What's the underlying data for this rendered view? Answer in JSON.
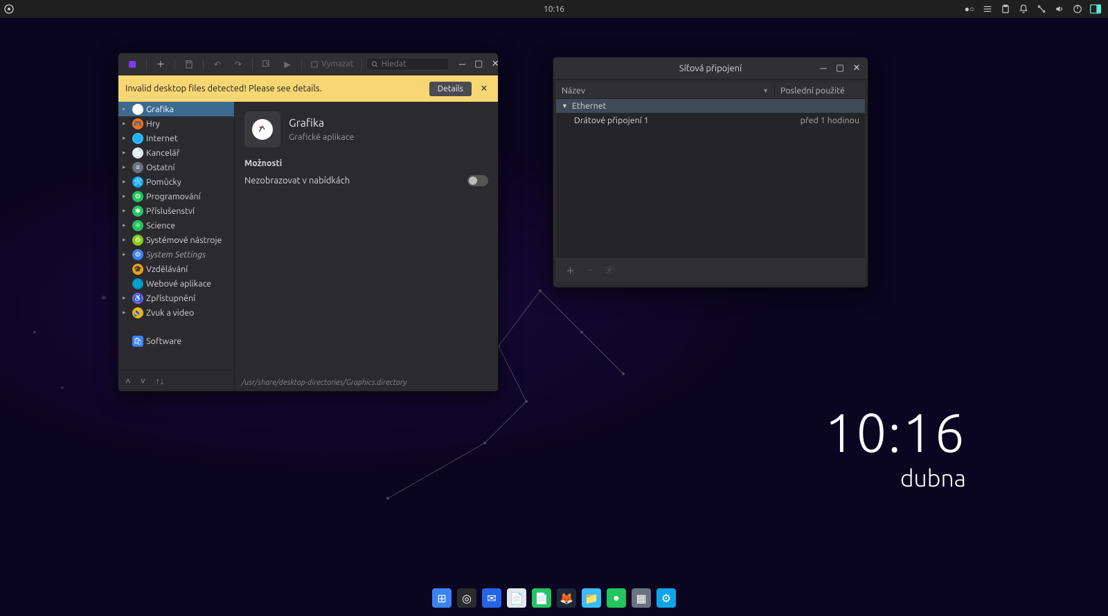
{
  "panel": {
    "clock": "10:16"
  },
  "desktop_clock": {
    "time": "10:16",
    "date": "dubna"
  },
  "menu_editor": {
    "toolbar": {
      "clear_label": "Vymazat",
      "search_placeholder": "Hledat"
    },
    "banner": {
      "message": "Invalid desktop files detected! Please see details.",
      "details_label": "Details"
    },
    "categories": [
      {
        "label": "Grafika",
        "icon_bg": "#ffffff",
        "glyph": "🖌",
        "selected": true,
        "expandable": true
      },
      {
        "label": "Hry",
        "icon_bg": "#f97316",
        "glyph": "🎮",
        "expandable": true
      },
      {
        "label": "Internet",
        "icon_bg": "#38bdf8",
        "glyph": "🌐",
        "expandable": true
      },
      {
        "label": "Kancelář",
        "icon_bg": "#e5e7eb",
        "glyph": "📄",
        "expandable": true
      },
      {
        "label": "Ostatní",
        "icon_bg": "#6b7280",
        "glyph": "≡",
        "expandable": true
      },
      {
        "label": "Pomůcky",
        "icon_bg": "#0ea5e9",
        "glyph": "🛠",
        "expandable": true
      },
      {
        "label": "Programování",
        "icon_bg": "#22c55e",
        "glyph": "⚙",
        "expandable": true
      },
      {
        "label": "Příslušenství",
        "icon_bg": "#22c55e",
        "glyph": "✱",
        "expandable": true
      },
      {
        "label": "Science",
        "icon_bg": "#22c55e",
        "glyph": "⚛",
        "expandable": true
      },
      {
        "label": "Systémové nástroje",
        "icon_bg": "#84cc16",
        "glyph": "⚙",
        "expandable": true
      },
      {
        "label": "System Settings",
        "icon_bg": "#3b82f6",
        "glyph": "⚙",
        "expandable": true,
        "italic": true
      },
      {
        "label": "Vzdělávání",
        "icon_bg": "#f59e0b",
        "glyph": "🎓",
        "expandable": false
      },
      {
        "label": "Webové aplikace",
        "icon_bg": "#0891b2",
        "glyph": "🌐",
        "expandable": false
      },
      {
        "label": "Zpřístupnění",
        "icon_bg": "#8b5cf6",
        "glyph": "♿",
        "expandable": true
      },
      {
        "label": "Zvuk a video",
        "icon_bg": "#eab308",
        "glyph": "🔊",
        "expandable": true
      }
    ],
    "extra_item": {
      "label": "Software",
      "icon_bg": "#3b82f6",
      "glyph": "🛍"
    },
    "detail": {
      "title": "Grafika",
      "subtitle": "Grafické aplikace",
      "section": "Možnosti",
      "option_hide": "Nezobrazovat v nabídkách",
      "option_hide_value": false,
      "path": "/usr/share/desktop-directories/Graphics.directory"
    }
  },
  "network": {
    "title": "Síťová připojení",
    "col_name": "Název",
    "col_last": "Poslední použité",
    "group": "Ethernet",
    "connections": [
      {
        "name": "Drátové připojení 1",
        "last": "před 1 hodinou"
      }
    ]
  },
  "dock": [
    {
      "name": "app-grid",
      "bg": "#3b82f6",
      "glyph": "⊞"
    },
    {
      "name": "budgie-logo",
      "bg": "#2b2b2f",
      "glyph": "◎"
    },
    {
      "name": "mail",
      "bg": "#2563eb",
      "glyph": "✉"
    },
    {
      "name": "text-editor",
      "bg": "#e5e7eb",
      "glyph": "📄"
    },
    {
      "name": "document",
      "bg": "#22c55e",
      "glyph": "📄"
    },
    {
      "name": "firefox",
      "bg": "#1e293b",
      "glyph": "🦊"
    },
    {
      "name": "files",
      "bg": "#38bdf8",
      "glyph": "📁"
    },
    {
      "name": "terminal",
      "bg": "#22c55e",
      "glyph": "●"
    },
    {
      "name": "menu-editor",
      "bg": "#6b7280",
      "glyph": "▦"
    },
    {
      "name": "settings",
      "bg": "#0ea5e9",
      "glyph": "⚙"
    }
  ]
}
